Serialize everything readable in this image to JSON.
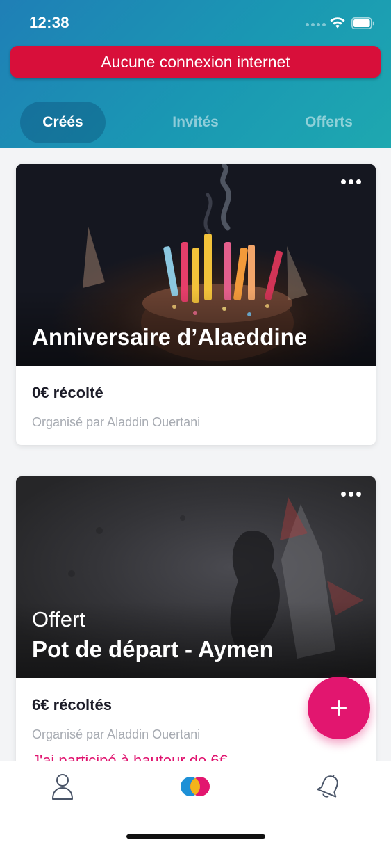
{
  "status_bar": {
    "time": "12:38"
  },
  "banner": {
    "text": "Aucune connexion internet"
  },
  "tabs": [
    {
      "label": "Créés",
      "active": true
    },
    {
      "label": "Invités",
      "active": false
    },
    {
      "label": "Offerts",
      "active": false
    }
  ],
  "cards": [
    {
      "subtitle": "",
      "title": "Anniversaire d’Alaeddine",
      "amount": "0€ récolté",
      "organizer": "Organisé par Aladdin Ouertani",
      "participation": ""
    },
    {
      "subtitle": "Offert",
      "title": "Pot de départ - Aymen",
      "amount": "6€ récoltés",
      "organizer": "Organisé par Aladdin Ouertani",
      "participation": "J'ai participé à hauteur de 6€"
    }
  ],
  "colors": {
    "header_gradient_start": "#1f7fb6",
    "header_gradient_end": "#1ea8b0",
    "banner": "#d80f3a",
    "fab": "#e2166f",
    "accent_pink": "#e0126e"
  },
  "icons": {
    "fab": "plus-icon",
    "nav": [
      "profile-icon",
      "app-logo-icon",
      "bell-icon"
    ]
  }
}
